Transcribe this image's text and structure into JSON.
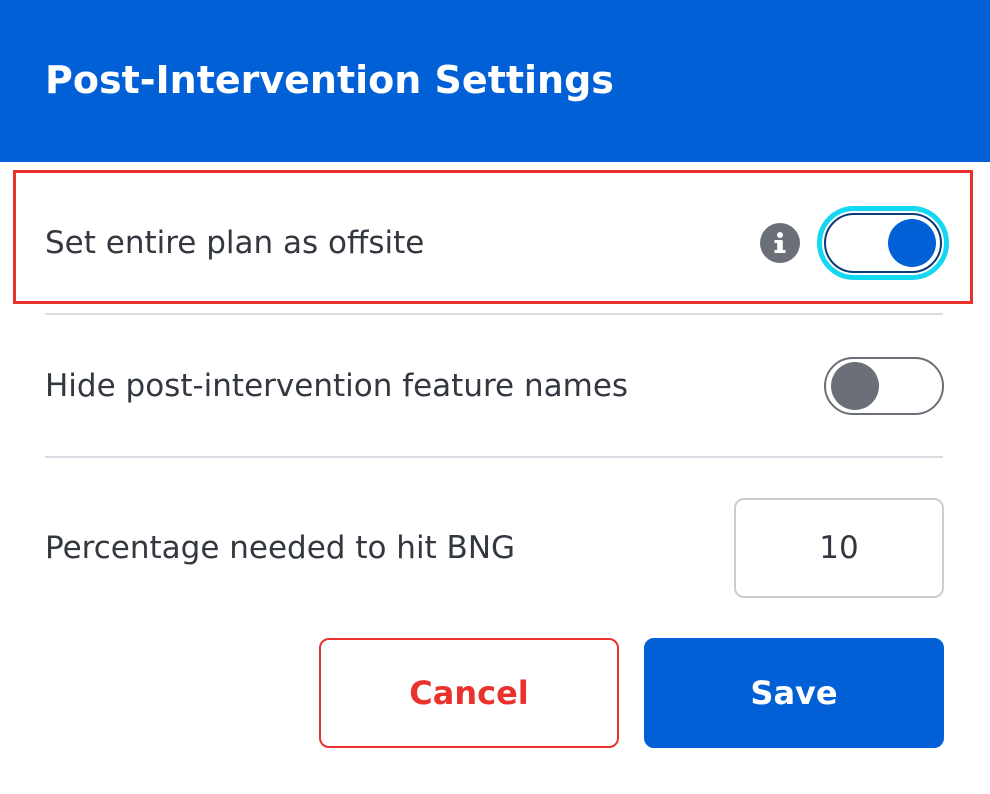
{
  "dialog": {
    "title": "Post-Intervention Settings"
  },
  "settings": {
    "offsite": {
      "label": "Set entire plan as offsite",
      "info_icon": "info-icon",
      "enabled": true
    },
    "hide_names": {
      "label": "Hide post-intervention feature names",
      "enabled": false
    },
    "bng_percentage": {
      "label": "Percentage needed to hit BNG",
      "value": "10"
    }
  },
  "actions": {
    "cancel_label": "Cancel",
    "save_label": "Save"
  },
  "colors": {
    "brand_blue": "#0260d6",
    "danger_red": "#e8322b",
    "focus_cyan": "#14d7f0",
    "muted_gray": "#6b7078"
  }
}
